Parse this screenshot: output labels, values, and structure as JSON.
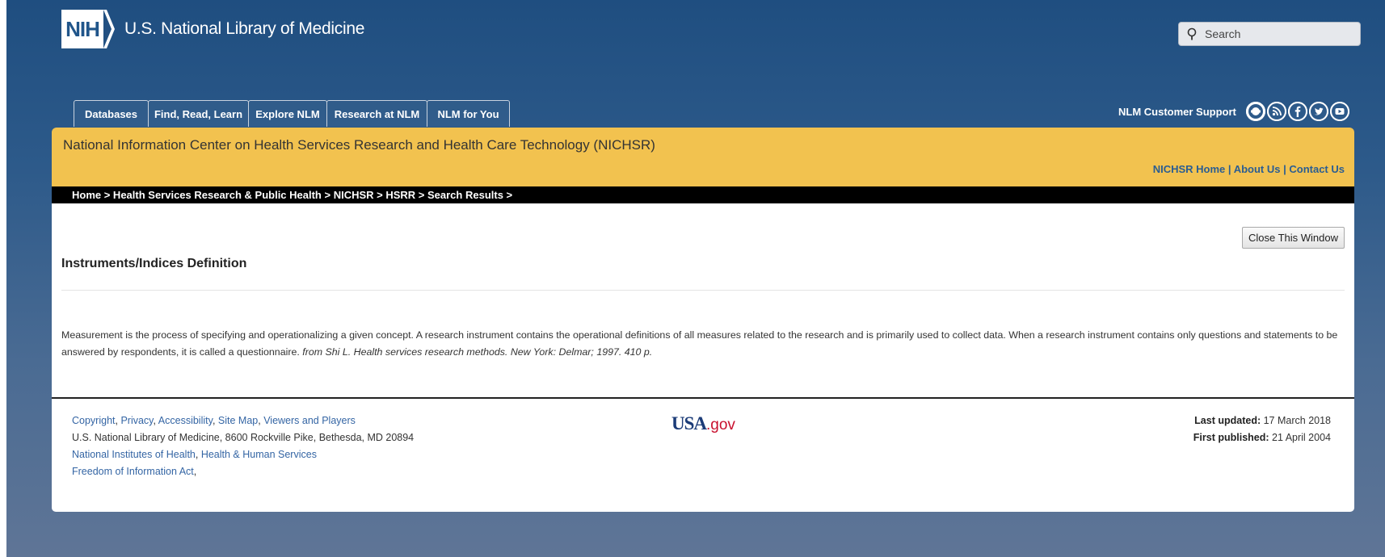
{
  "header": {
    "logo_badge": "NIH",
    "logo_title": "U.S. National Library of Medicine",
    "search_placeholder": "Search"
  },
  "nav": {
    "tabs": [
      {
        "label": "Databases"
      },
      {
        "label": "Find, Read, Learn"
      },
      {
        "label": "Explore NLM"
      },
      {
        "label": "Research at NLM"
      },
      {
        "label": "NLM for You"
      }
    ],
    "support_label": "NLM Customer Support",
    "social_icons": [
      "customer-support-icon",
      "rss-icon",
      "facebook-icon",
      "twitter-icon",
      "youtube-icon"
    ]
  },
  "banner": {
    "title": "National Information Center on Health Services Research and Health Care Technology (NICHSR)",
    "links": [
      {
        "label": "NICHSR Home"
      },
      {
        "label": "About Us"
      },
      {
        "label": "Contact Us"
      }
    ],
    "separator": "|"
  },
  "breadcrumb": "Home > Health Services Research & Public Health > NICHSR > HSRR > Search Results >",
  "content": {
    "close_button": "Close This Window",
    "title": "Instruments/Indices Definition",
    "text": "Measurement is the process of specifying and operationalizing a given concept. A research instrument contains the operational definitions of all measures related to the research and is primarily used to collect data. When a research instrument contains only questions and statements to be answered by respondents, it is called a questionnaire.",
    "source": "from Shi L. Health services research methods. New York: Delmar; 1997. 410 p."
  },
  "footer": {
    "links_line1": [
      "Copyright",
      "Privacy",
      "Accessibility",
      "Site Map",
      "Viewers and Players"
    ],
    "address": "U.S. National Library of Medicine, 8600 Rockville Pike, Bethesda, MD 20894",
    "links_line3": [
      "National Institutes of Health",
      "Health & Human Services"
    ],
    "links_line4": [
      "Freedom of Information Act"
    ],
    "usa_logo": "USA",
    "usa_logo_suffix": ".gov",
    "last_updated_label": "Last updated:",
    "last_updated": "17 March 2018",
    "first_published_label": "First published:",
    "first_published": "21 April 2004"
  },
  "colors": {
    "banner": "#f2c24f",
    "link": "#3465a4",
    "header_bg": "#1f4e80"
  }
}
